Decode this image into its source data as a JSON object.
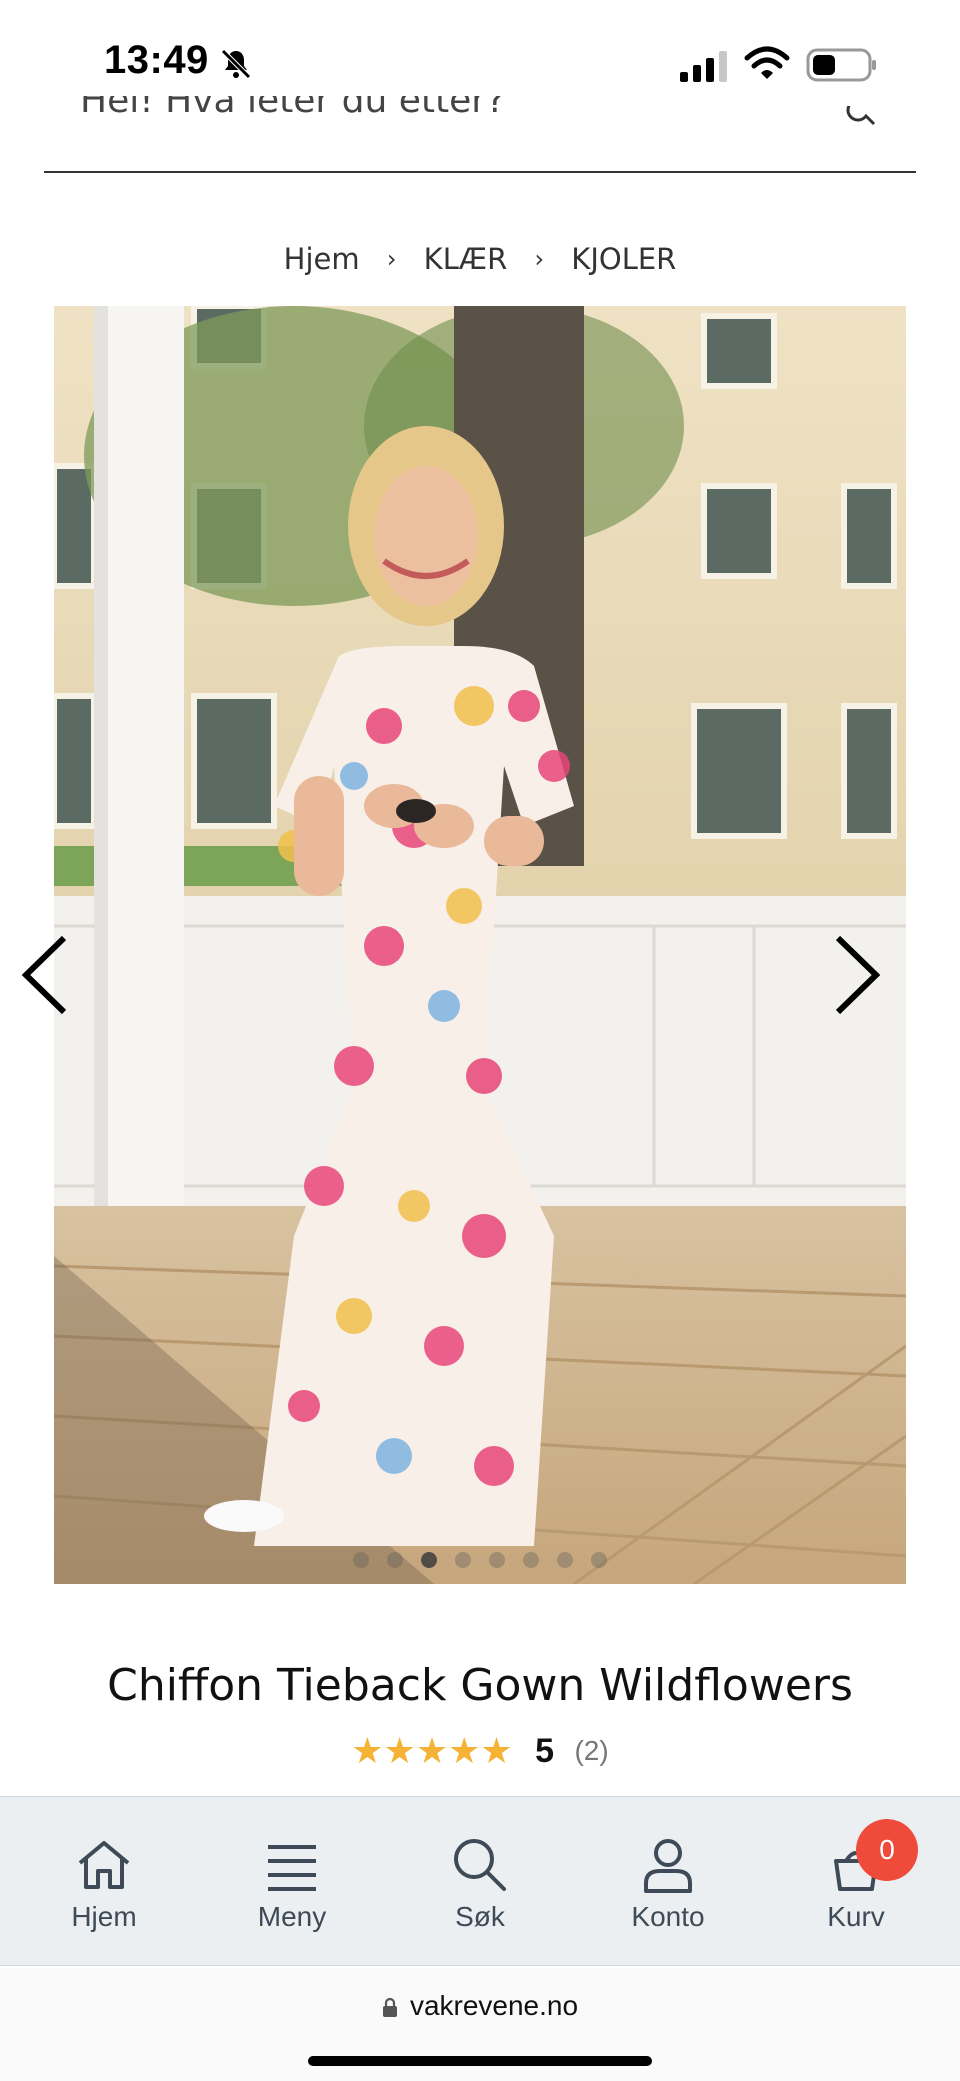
{
  "status_bar": {
    "time": "13:49"
  },
  "search": {
    "text": "Hei! Hva leter du etter?"
  },
  "breadcrumb": {
    "items": [
      "Hjem",
      "KLÆR",
      "KJOLER"
    ]
  },
  "gallery": {
    "dot_count": 8,
    "active_index": 2
  },
  "product": {
    "title": "Chiffon Tieback Gown Wildflowers",
    "rating_value": "5",
    "rating_count": "(2)",
    "stars": 5
  },
  "bottom_nav": {
    "items": [
      {
        "label": "Hjem",
        "icon": "home-icon"
      },
      {
        "label": "Meny",
        "icon": "menu-icon"
      },
      {
        "label": "Søk",
        "icon": "search-icon"
      },
      {
        "label": "Konto",
        "icon": "user-icon"
      },
      {
        "label": "Kurv",
        "icon": "cart-icon"
      }
    ],
    "cart_count": "0"
  },
  "browser": {
    "url": "vakrevene.no"
  },
  "colors": {
    "star": "#f5b335",
    "badge": "#ef4b3a",
    "nav_bg": "#eceff1",
    "nav_text": "#3e4a57"
  }
}
